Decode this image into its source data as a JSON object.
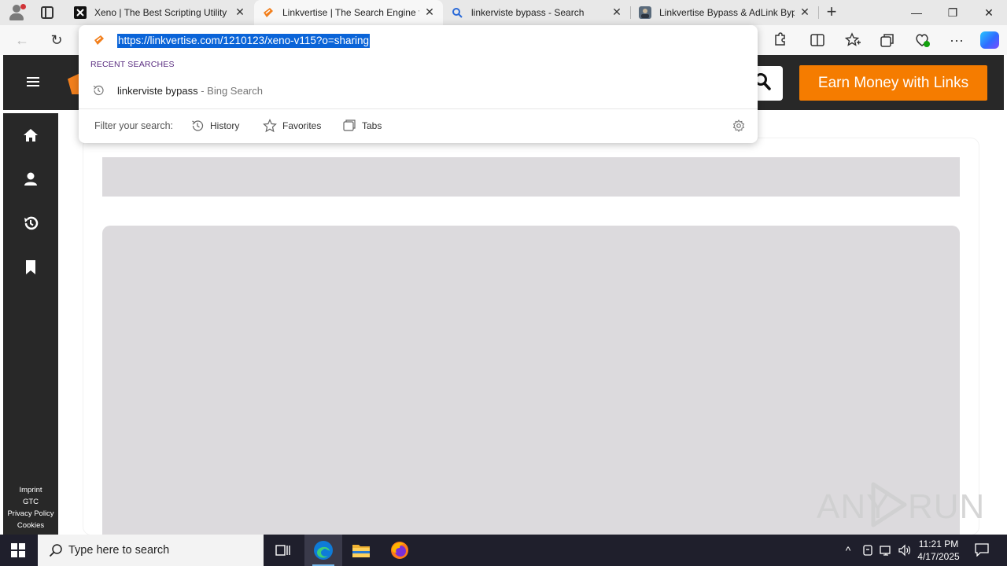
{
  "browser": {
    "tabs": [
      {
        "title": "Xeno | The Best Scripting Utility",
        "icon": "xeno-favicon",
        "active": false
      },
      {
        "title": "Linkvertise | The Search Engine fo",
        "icon": "linkvertise-favicon",
        "active": true
      },
      {
        "title": "linkerviste bypass - Search",
        "icon": "search-favicon",
        "active": false
      },
      {
        "title": "Linkvertise Bypass & AdLink Byp",
        "icon": "site-favicon",
        "active": false
      }
    ],
    "close_glyph": "✕",
    "new_tab_glyph": "+",
    "window_controls": {
      "minimize": "—",
      "restore": "❐",
      "close": "✕"
    },
    "toolbar_glyphs": {
      "back": "←",
      "refresh": "↻",
      "more": "···"
    }
  },
  "omnibox": {
    "url": "https://linkvertise.com/1210123/xeno-v115?o=sharing",
    "section_label": "RECENT SEARCHES",
    "suggestion_query": "linkerviste bypass",
    "suggestion_source": " - Bing Search",
    "filter_label": "Filter your search:",
    "filters": [
      "History",
      "Favorites",
      "Tabs"
    ]
  },
  "page": {
    "earn_button": "Earn Money with Links",
    "sidebar_links": [
      "Imprint",
      "GTC",
      "Privacy Policy",
      "Cookies"
    ],
    "colors": {
      "header": "#282828",
      "accent": "#f57c00",
      "skeleton": "#dcdadd"
    }
  },
  "watermark": {
    "left": "ANY",
    "right": "RUN"
  },
  "taskbar": {
    "search_placeholder": "Type here to search",
    "time": "11:21 PM",
    "date": "4/17/2025",
    "tray_chevron": "^"
  }
}
